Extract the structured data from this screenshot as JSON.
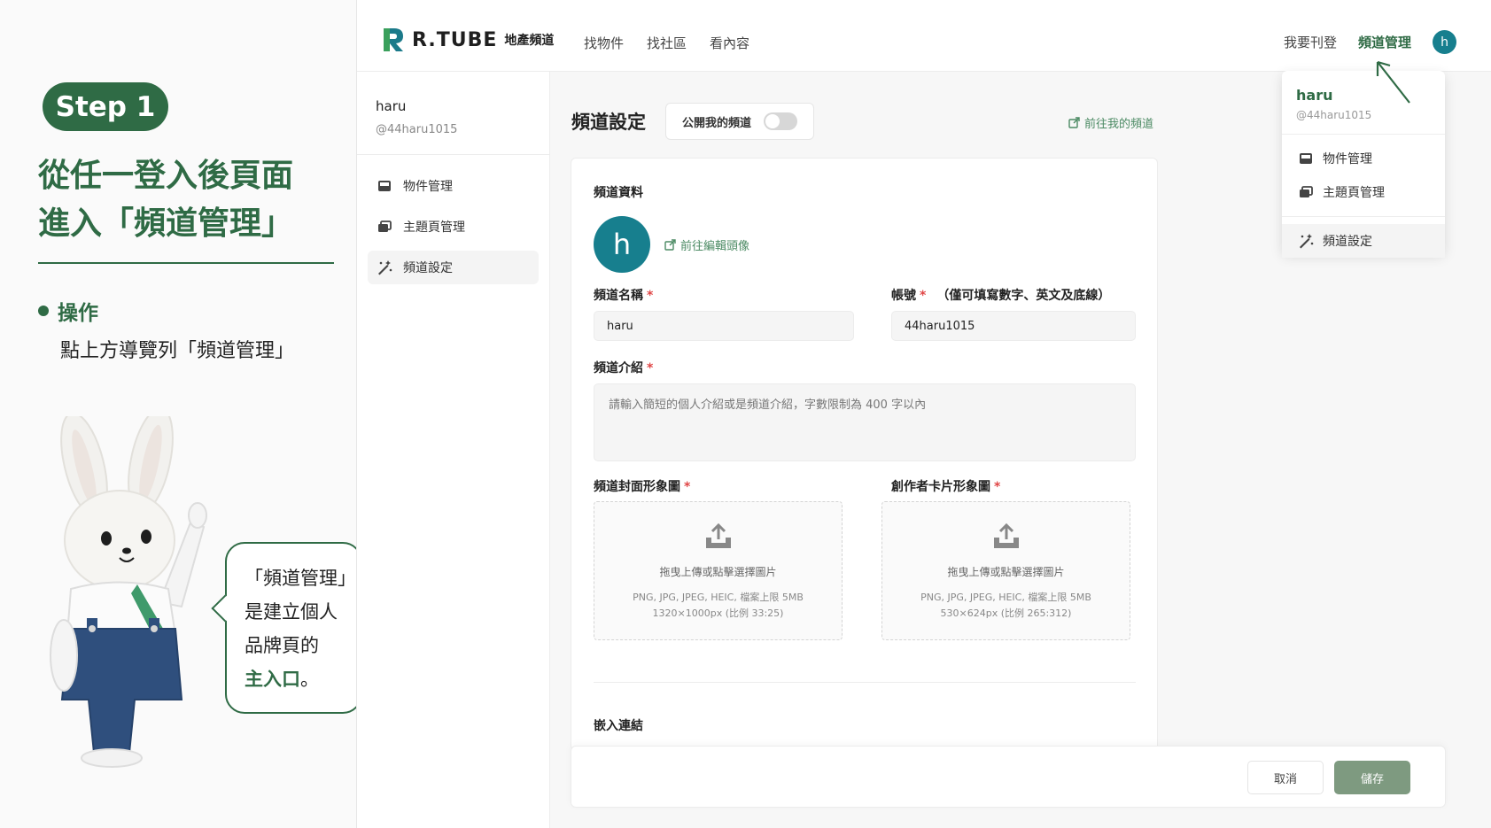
{
  "tutorial": {
    "step": "Step 1",
    "title_line1": "從任一登入後頁面",
    "title_line2": "進入「頻道管理」",
    "bullet": "操作",
    "desc": "點上方導覽列「頻道管理」",
    "bubble": {
      "l1": "「頻道管理」",
      "l2": "是建立個人",
      "l3": "品牌頁的",
      "l4": "主入口",
      "l4_end": "。"
    }
  },
  "nav": {
    "brand": "R.TUBE",
    "brand_sub": "地產頻道",
    "links": [
      "找物件",
      "找社區",
      "看內容"
    ],
    "post": "我要刊登",
    "channel_mgmt": "頻道管理",
    "avatar_letter": "h"
  },
  "dropdown": {
    "name": "haru",
    "handle": "@44haru1015",
    "items": [
      "物件管理",
      "主題頁管理",
      "頻道設定"
    ]
  },
  "sidebar": {
    "name": "haru",
    "handle": "@44haru1015",
    "items": [
      "物件管理",
      "主題頁管理",
      "頻道設定"
    ]
  },
  "main": {
    "title": "頻道設定",
    "public_label": "公開我的頻道",
    "public_on": false,
    "goto_channel": "前往我的頻道",
    "section_info": "頻道資料",
    "avatar_letter": "h",
    "edit_avatar": "前往編輯頭像",
    "name_label": "頻道名稱",
    "name_value": "haru",
    "account_label": "帳號",
    "account_hint": "（僅可填寫數字、英文及底線）",
    "account_value": "44haru1015",
    "intro_label": "頻道介紹",
    "intro_placeholder": "請輸入簡短的個人介紹或是頻道介紹，字數限制為 400 字以內",
    "cover_label": "頻道封面形象圖",
    "card_label": "創作者卡片形象圖",
    "upload_text": "拖曳上傳或點擊選擇圖片",
    "cover_format": "PNG, JPG, JPEG, HEIC, 檔案上限 5MB",
    "cover_size": "1320×1000px (比例 33:25)",
    "card_format": "PNG, JPG, JPEG, HEIC, 檔案上限 5MB",
    "card_size": "530×624px (比例 265:312)",
    "embed_label": "嵌入連結",
    "required_mark": "*"
  },
  "footer": {
    "cancel": "取消",
    "save": "儲存"
  },
  "colors": {
    "brand_green": "#2f6b45",
    "avatar_teal": "#177f8e",
    "link_green": "#4b8a63",
    "save_green": "#7e9a80"
  }
}
